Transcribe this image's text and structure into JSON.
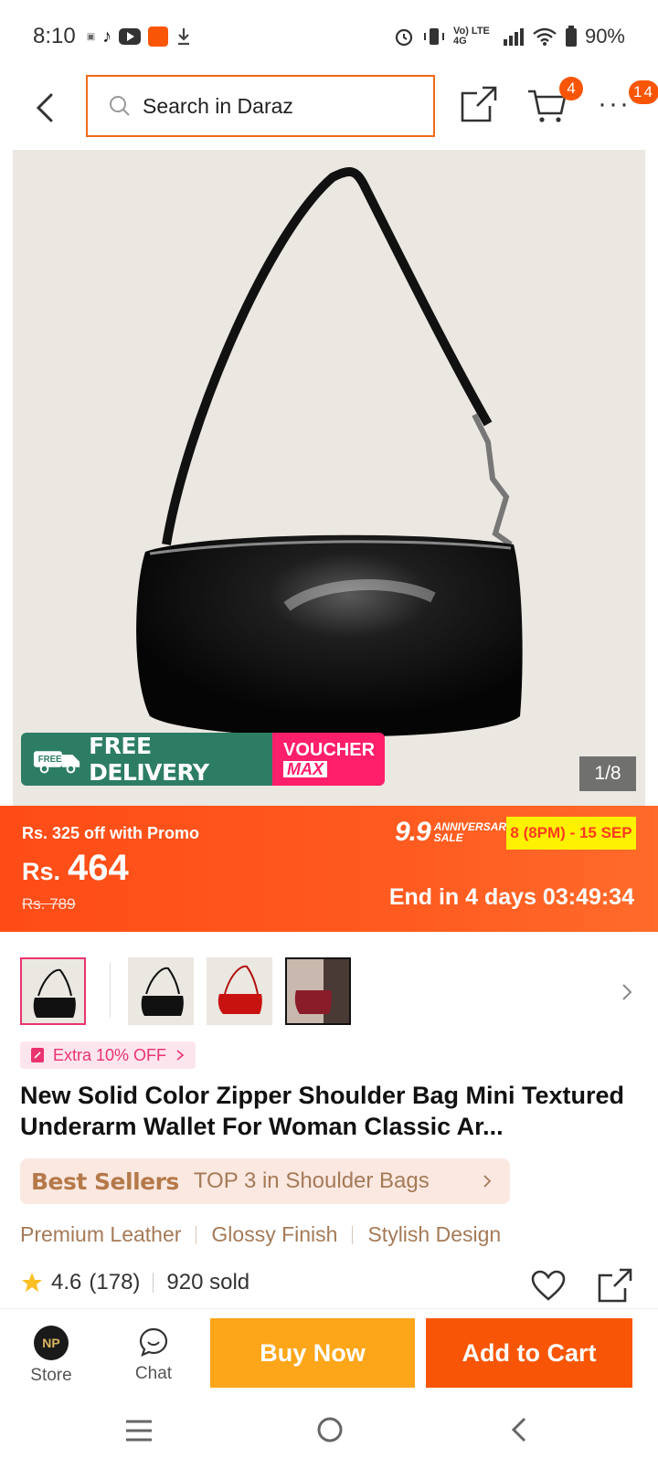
{
  "status_bar": {
    "time": "8:10",
    "network": "Vo) LTE 4G",
    "battery": "90%"
  },
  "header": {
    "search_placeholder": "Search in Daraz",
    "cart_badge": "4",
    "more_badge": "14"
  },
  "hero": {
    "image_counter": "1/8",
    "free_delivery_tag": "FREE",
    "free_delivery": "FREE DELIVERY",
    "voucher_line1": "VOUCHER",
    "voucher_line2": "MAX"
  },
  "price_band": {
    "promo_text": "Rs. 325 off with Promo",
    "currency": "Rs.",
    "price": "464",
    "old_price": "Rs. 789",
    "sale_number": "9.9",
    "sale_line1": "ANNIVERSARY",
    "sale_line2": "SALE",
    "sale_dates": "8 (8PM) - 15 SEP",
    "countdown": "End in 4 days 03:49:34"
  },
  "product": {
    "extra_off": "Extra 10% OFF",
    "title": "New Solid Color Zipper Shoulder Bag Mini Textured Underarm Wallet For Woman Classic Ar...",
    "best_sellers_label": "Best Sellers",
    "best_sellers_rank": "TOP 3 in Shoulder Bags",
    "features": [
      "Premium Leather",
      "Glossy Finish",
      "Stylish Design"
    ],
    "rating": "4.6",
    "reviews": "(178)",
    "sold": "920 sold"
  },
  "action_bar": {
    "store_label": "Store",
    "store_logo": "NP",
    "chat_label": "Chat",
    "buy_now": "Buy Now",
    "add_to_cart": "Add to Cart"
  },
  "colors": {
    "accent": "#f85606",
    "buy_now": "#fda619",
    "free_delivery_green": "#2d7d65",
    "voucher_pink": "#ff1f6a",
    "sale_yellow": "#fff200"
  }
}
